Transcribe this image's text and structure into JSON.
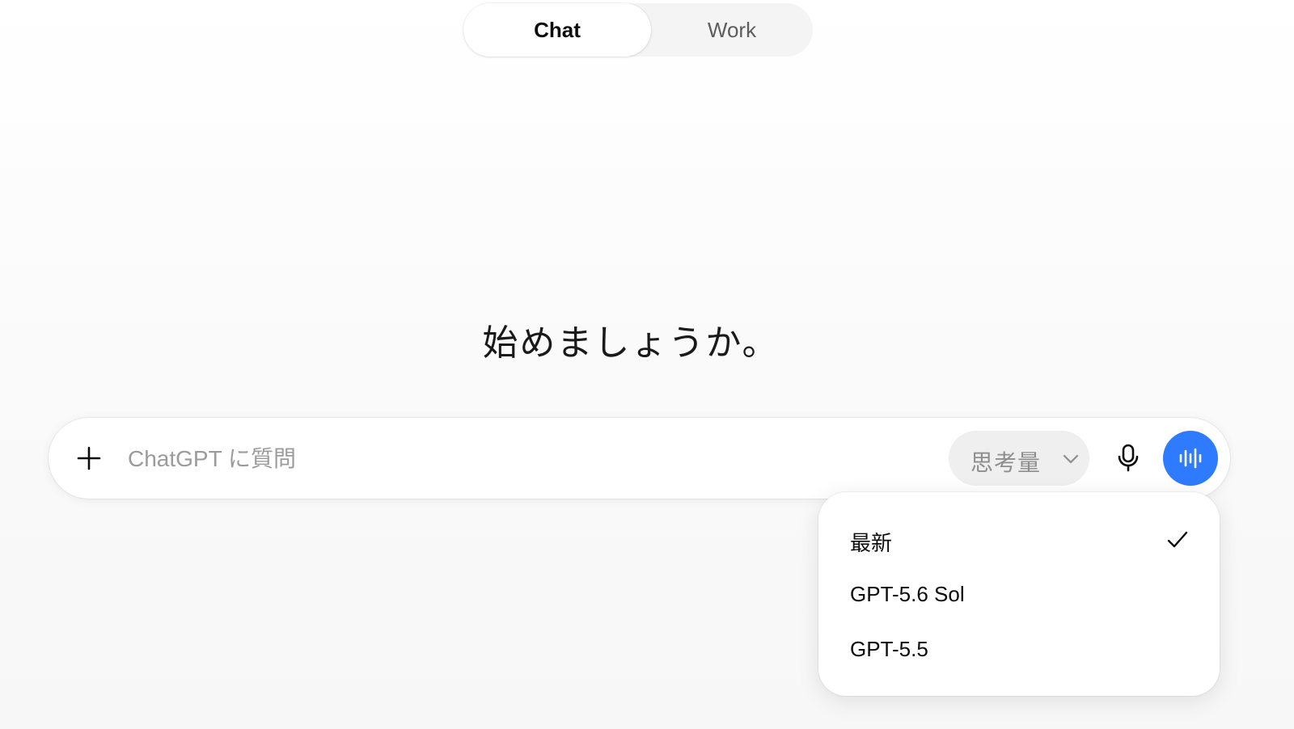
{
  "mode_switch": {
    "tabs": [
      {
        "label": "Chat",
        "selected": true
      },
      {
        "label": "Work",
        "selected": false
      }
    ]
  },
  "hero": {
    "title": "始めましょうか。"
  },
  "composer": {
    "placeholder": "ChatGPT に質問",
    "value": "",
    "thinking_label": "思考量",
    "icons": {
      "attach": "plus-icon",
      "thinking": "chevron-down-icon",
      "dictate": "microphone-icon",
      "voice": "voice-waveform-icon"
    }
  },
  "model_menu": {
    "items": [
      {
        "label": "最新",
        "selected": true
      },
      {
        "label": "GPT-5.6 Sol",
        "selected": false
      },
      {
        "label": "GPT-5.5",
        "selected": false
      }
    ],
    "selected_icon": "checkmark-icon"
  },
  "colors": {
    "accent": "#2f7bff",
    "text": "#0d0d0d",
    "placeholder": "#9b9b9b",
    "pill_background": "#efefef"
  }
}
